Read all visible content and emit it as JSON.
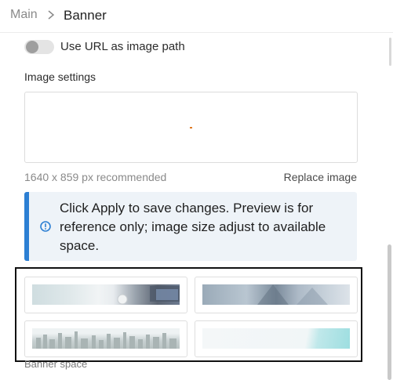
{
  "breadcrumb": {
    "root": "Main",
    "current": "Banner"
  },
  "url_toggle": {
    "label": "Use URL as image path",
    "on": false
  },
  "image_settings": {
    "label": "Image settings",
    "hint": "1640 x 859 px recommended",
    "replace_label": "Replace image"
  },
  "info_notice": {
    "text": "Click Apply to save changes. Preview is for reference only; image size adjust to available space.",
    "icon": "info-circle-icon",
    "accent_color": "#2c7fd3"
  },
  "banner_options": [
    {
      "thumbnail": "office-desk-laptop"
    },
    {
      "thumbnail": "skyscrapers-glass"
    },
    {
      "thumbnail": "city-skyline"
    },
    {
      "thumbnail": "abstract-teal"
    }
  ],
  "banner_space_label": "Banner space"
}
